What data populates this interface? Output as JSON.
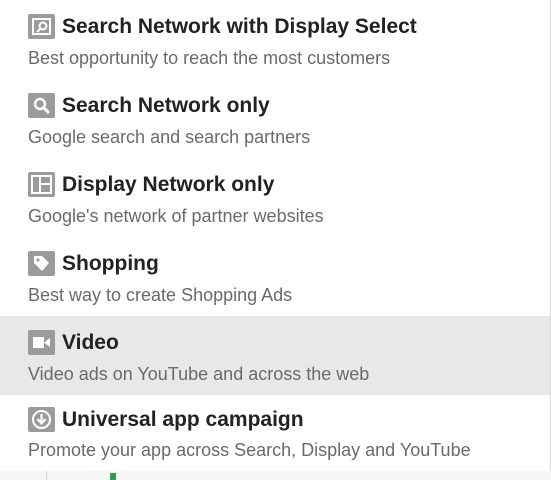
{
  "menu": {
    "items": [
      {
        "title": "Search Network with Display Select",
        "description": "Best opportunity to reach the most customers",
        "icon": "search-display-icon"
      },
      {
        "title": "Search Network only",
        "description": "Google search and search partners",
        "icon": "magnifier-icon"
      },
      {
        "title": "Display Network only",
        "description": "Google's network of partner websites",
        "icon": "layout-icon"
      },
      {
        "title": "Shopping",
        "description": "Best way to create Shopping Ads",
        "icon": "tag-icon"
      },
      {
        "title": "Video",
        "description": "Video ads on YouTube and across the web",
        "icon": "video-camera-icon"
      },
      {
        "title": "Universal app campaign",
        "description": "Promote your app across Search, Display and YouTube",
        "icon": "download-icon"
      }
    ],
    "highlighted_index": 4
  },
  "colors": {
    "icon_background": "#9b9b9b",
    "title_text": "#222222",
    "description_text": "#6a6a6a",
    "highlight_background": "#e8e8e8"
  }
}
